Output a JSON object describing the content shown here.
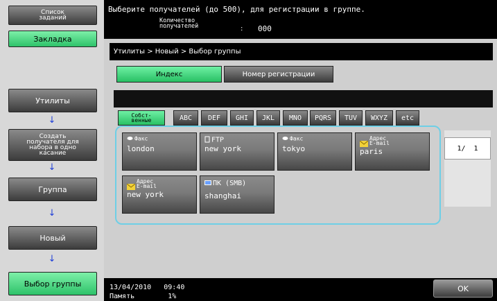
{
  "sidebar": {
    "job_list": "Список\nзаданий",
    "bookmark": "Закладка",
    "steps": [
      {
        "label": "Утилиты"
      },
      {
        "label": "Создать\nполучателя для\nнабора в одно\nкасание"
      },
      {
        "label": "Группа"
      },
      {
        "label": "Новый"
      },
      {
        "label": "Выбор группы"
      }
    ],
    "arrow_glyph": "↓"
  },
  "header": {
    "message": "Выберите получателей (до 500), для регистрации в группе.",
    "count_label": "Количество\nполучателей",
    "count_colon": ":",
    "count_value": "000"
  },
  "main": {
    "breadcrumb": "Утилиты > Новый > Выбор группы",
    "tabs": {
      "index": "Индекс",
      "registration": "Номер регистрации"
    },
    "alpha_tabs": [
      "Собст-\nвенные",
      "ABC",
      "DEF",
      "GHI",
      "JKL",
      "MNO",
      "PQRS",
      "TUV",
      "WXYZ",
      "etc"
    ],
    "destinations": [
      {
        "type": "Факс",
        "name": "london",
        "icon": "fax-icon"
      },
      {
        "type": "FTP",
        "name": "new york",
        "icon": "ftp-icon"
      },
      {
        "type": "Факс",
        "name": "tokyo",
        "icon": "fax-icon"
      },
      {
        "type": "Адрес\nE-mail",
        "name": "paris",
        "icon": "email-icon"
      },
      {
        "type": "Адрес\nE-mail",
        "name": "new york",
        "icon": "email-icon"
      },
      {
        "type": "ПК (SMB)",
        "name": "shanghai",
        "icon": "pc-icon"
      }
    ],
    "page_indicator": "1/  1"
  },
  "footer": {
    "date": "13/04/2010   09:40",
    "memory": "Память        1%",
    "ok": "OK"
  },
  "colors": {
    "accent_green": "#2ec26a",
    "highlight_border": "#6ecfe6",
    "arrow_blue": "#1f3fd8"
  }
}
